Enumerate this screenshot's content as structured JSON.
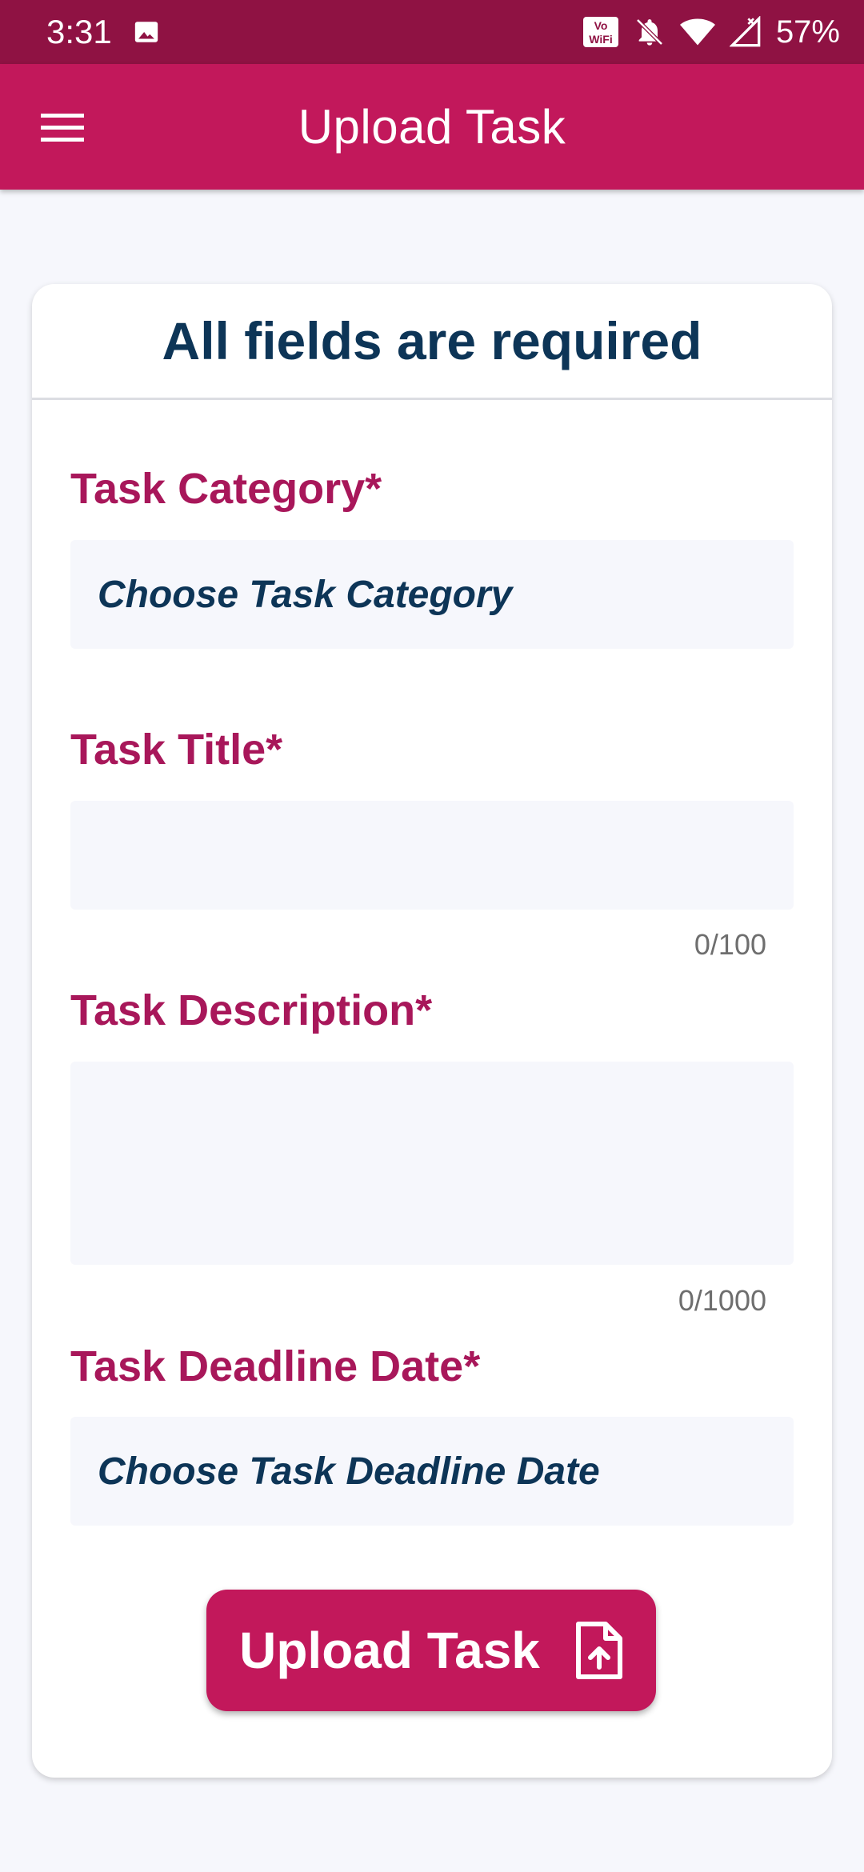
{
  "status_bar": {
    "time": "3:31",
    "battery": "57%",
    "icons": [
      "gallery-icon",
      "vowifi-icon",
      "bell-off-icon",
      "wifi-icon",
      "signal-icon"
    ]
  },
  "app_bar": {
    "title": "Upload Task",
    "menu_icon": "hamburger-menu-icon"
  },
  "form": {
    "heading": "All fields are required",
    "category": {
      "label": "Task Category*",
      "value": "Choose Task Category"
    },
    "title": {
      "label": "Task Title*",
      "value": "",
      "counter": "0/100"
    },
    "description": {
      "label": "Task Description*",
      "value": "",
      "counter": "0/1000"
    },
    "deadline": {
      "label": "Task Deadline Date*",
      "value": "Choose Task Deadline Date"
    },
    "submit": {
      "label": "Upload Task",
      "icon": "file-upload-icon"
    }
  },
  "colors": {
    "status_bar": "#8f1243",
    "primary": "#c2185b",
    "label": "#a8175a",
    "heading": "#0d3557",
    "background": "#f6f7fc"
  }
}
